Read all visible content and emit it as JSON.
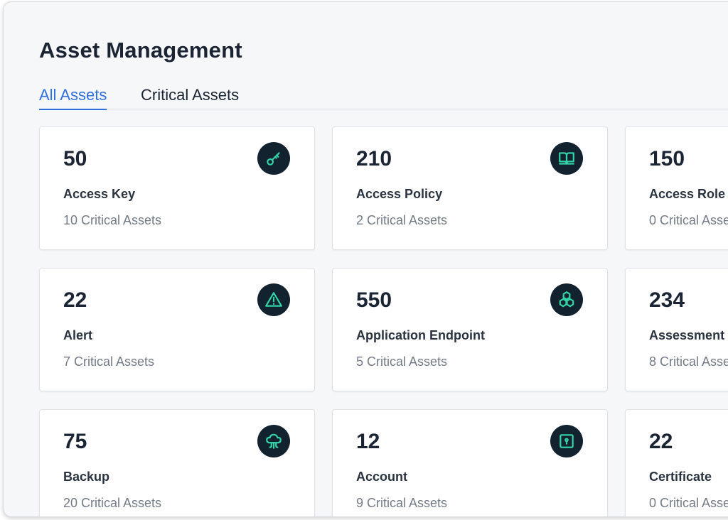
{
  "page": {
    "title": "Asset Management"
  },
  "tabs": [
    {
      "label": "All Assets",
      "active": true
    },
    {
      "label": "Critical Assets",
      "active": false
    }
  ],
  "colors": {
    "accent": "#2f6fe0",
    "icon_bg": "#13222f",
    "icon_stroke": "#33d6a8"
  },
  "cards": [
    {
      "count": "50",
      "name": "Access Key",
      "critical": "10 Critical Assets",
      "icon": "key-icon"
    },
    {
      "count": "210",
      "name": "Access Policy",
      "critical": "2 Critical Assets",
      "icon": "book-icon"
    },
    {
      "count": "150",
      "name": "Access Role",
      "critical": "0 Critical Asse"
    },
    {
      "count": "22",
      "name": "Alert",
      "critical": "7 Critical Assets",
      "icon": "warning-icon"
    },
    {
      "count": "550",
      "name": "Application Endpoint",
      "critical": "5 Critical Assets",
      "icon": "hexagon-cluster-icon"
    },
    {
      "count": "234",
      "name": "Assessment",
      "critical": "8 Critical Asse"
    },
    {
      "count": "75",
      "name": "Backup",
      "critical": "20 Critical Assets",
      "icon": "cloud-backup-icon"
    },
    {
      "count": "12",
      "name": "Account",
      "critical": "9 Critical Assets",
      "icon": "keyhole-box-icon"
    },
    {
      "count": "22",
      "name": "Certificate",
      "critical": "0 Critical Asse"
    }
  ]
}
